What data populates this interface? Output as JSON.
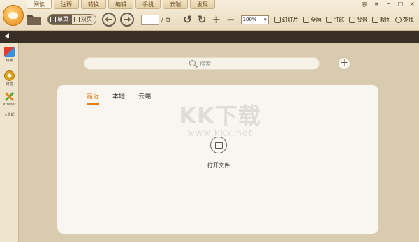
{
  "tabs": [
    "阅读",
    "注释",
    "转换",
    "编辑",
    "手机",
    "云端",
    "发现"
  ],
  "toolbar": {
    "single_page": "单页",
    "double_page": "双页",
    "page_unit": "/ 页",
    "zoom_value": "100%",
    "slideshow": "幻灯片",
    "fullscreen": "全屏",
    "print": "打印",
    "background": "背景",
    "screenshot": "截图",
    "find": "查找"
  },
  "window_controls": [
    "衣",
    "≡",
    "−",
    "□",
    "×"
  ],
  "sidebar": {
    "items": [
      {
        "label": "转换"
      },
      {
        "label": "财富"
      },
      {
        "label": "Xpaper"
      },
      {
        "label": "收起"
      }
    ],
    "collapse_prefix": "<"
  },
  "search": {
    "placeholder": "搜索"
  },
  "add_button": "+",
  "panel": {
    "tabs": [
      "最近",
      "本地",
      "云端"
    ],
    "watermark_main": "KK下载",
    "watermark_sub": "www.kkx.net",
    "open_file": "打开文件"
  }
}
